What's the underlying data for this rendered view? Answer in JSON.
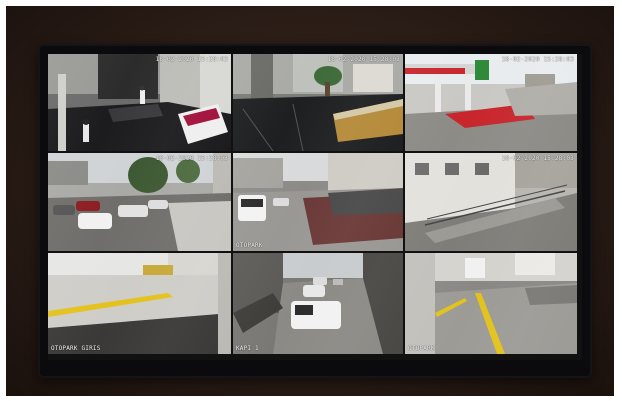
{
  "cameras": [
    {
      "id": "cam-1",
      "timestamp": "18-02-2020 15:28:03",
      "label": ""
    },
    {
      "id": "cam-2",
      "timestamp": "18-02-2020 15:28:03",
      "label": ""
    },
    {
      "id": "cam-3",
      "timestamp": "18-02-2020 15:28:03",
      "label": ""
    },
    {
      "id": "cam-4",
      "timestamp": "18-02-2020 15:28:03",
      "label": ""
    },
    {
      "id": "cam-5",
      "timestamp": "",
      "label": "OTOPARK"
    },
    {
      "id": "cam-6",
      "timestamp": "18-02-2020 15:28:03",
      "label": ""
    },
    {
      "id": "cam-7",
      "timestamp": "",
      "label": "OTOPARK GIRIS"
    },
    {
      "id": "cam-8",
      "timestamp": "",
      "label": "KAPI 1"
    },
    {
      "id": "cam-9",
      "timestamp": "",
      "label": "OTOPARK"
    }
  ],
  "colors": {
    "wall": "#2a1c16",
    "bezel": "#0b0b0d",
    "accent_yellow": "#e3c21d",
    "accent_red": "#c8252c"
  }
}
